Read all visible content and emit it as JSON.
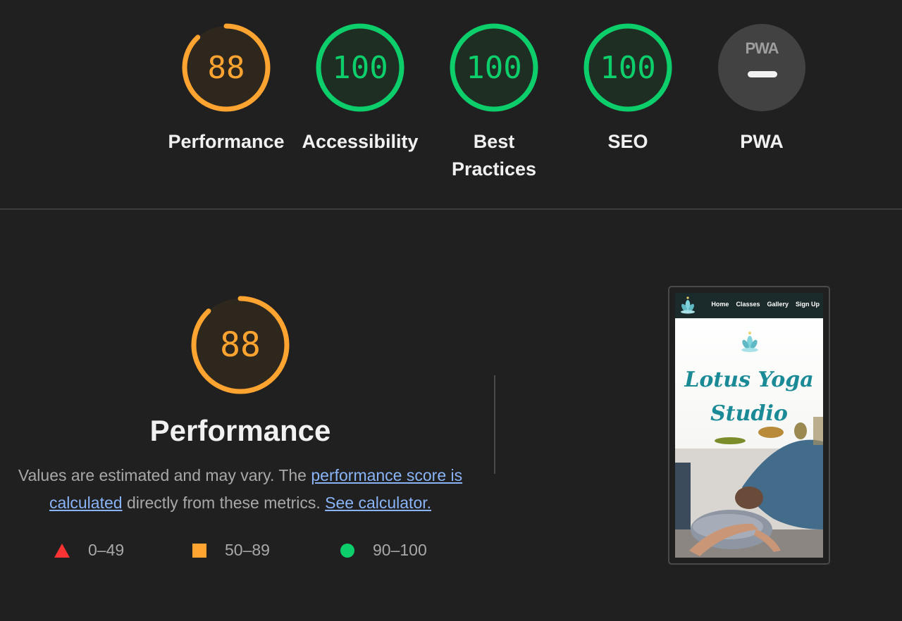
{
  "categories": [
    {
      "id": "performance",
      "score": "88",
      "score_value": 88,
      "label": "Performance",
      "color": "#ffa431"
    },
    {
      "id": "accessibility",
      "score": "100",
      "score_value": 100,
      "label": "Accessibility",
      "color": "#0cce6b"
    },
    {
      "id": "best-practices",
      "score": "100",
      "score_value": 100,
      "label": "Best Practices",
      "color": "#0cce6b"
    },
    {
      "id": "seo",
      "score": "100",
      "score_value": 100,
      "label": "SEO",
      "color": "#0cce6b"
    },
    {
      "id": "pwa",
      "badge": "PWA",
      "label": "PWA",
      "color": "#424242"
    }
  ],
  "performance": {
    "score": "88",
    "score_value": 88,
    "title": "Performance",
    "description_before": "Values are estimated and may vary. The",
    "link_score": "performance score is calculated",
    "description_middle": "directly from these metrics.",
    "link_calculator": "See calculator."
  },
  "legend": [
    {
      "shape": "triangle",
      "range": "0–49",
      "color": "#ff3333"
    },
    {
      "shape": "square",
      "range": "50–89",
      "color": "#ffa431"
    },
    {
      "shape": "circle",
      "range": "90–100",
      "color": "#0cce6b"
    }
  ],
  "screenshot": {
    "nav_links": [
      "Home",
      "Classes",
      "Gallery",
      "Sign Up"
    ],
    "site_title_line1": "Lotus Yoga",
    "site_title_line2": "Studio"
  }
}
